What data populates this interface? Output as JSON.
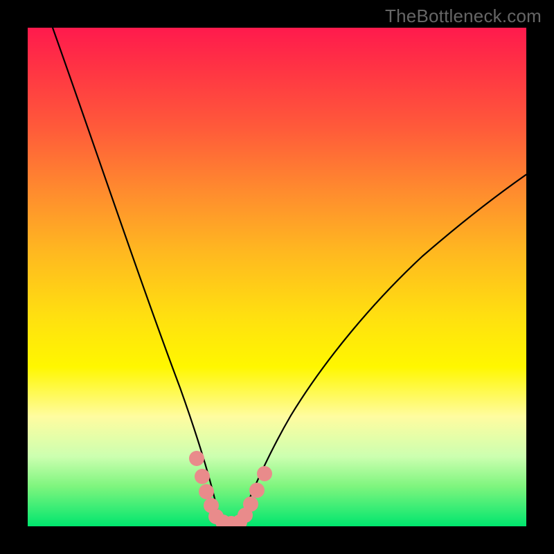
{
  "watermark": "TheBottleneck.com",
  "colors": {
    "frame": "#000000",
    "curve": "#000000",
    "marker": "#e98b8b",
    "gradient_stops": [
      "#ff1a4d",
      "#ff3344",
      "#ff5a3a",
      "#ff8c2e",
      "#ffb820",
      "#ffe010",
      "#fff700",
      "#fffca0",
      "#ccffb0",
      "#7ef57e",
      "#00e66e"
    ]
  },
  "chart_data": {
    "type": "line",
    "title": "",
    "xlabel": "",
    "ylabel": "",
    "xlim": [
      0,
      100
    ],
    "ylim": [
      0,
      100
    ],
    "grid": false,
    "legend": false,
    "series": [
      {
        "name": "left-curve",
        "x": [
          5,
          10,
          15,
          20,
          25,
          30,
          33,
          35,
          36.5,
          38
        ],
        "y": [
          100,
          82,
          64,
          47,
          32,
          18,
          10,
          5,
          2,
          0
        ]
      },
      {
        "name": "right-curve",
        "x": [
          42,
          44,
          46,
          50,
          55,
          60,
          65,
          70,
          75,
          80,
          85,
          90,
          95,
          100
        ],
        "y": [
          0,
          3,
          7,
          14,
          23,
          31,
          38,
          44,
          50,
          55,
          60,
          64,
          68,
          71
        ]
      },
      {
        "name": "highlight-markers",
        "x": [
          33,
          34.5,
          35.5,
          36.5,
          37.5,
          39,
          40.5,
          42,
          43,
          44,
          45.5,
          47
        ],
        "y": [
          13,
          9,
          6,
          3.5,
          1.5,
          0.5,
          0.4,
          0.6,
          1.5,
          3.5,
          6.5,
          10
        ]
      }
    ]
  }
}
